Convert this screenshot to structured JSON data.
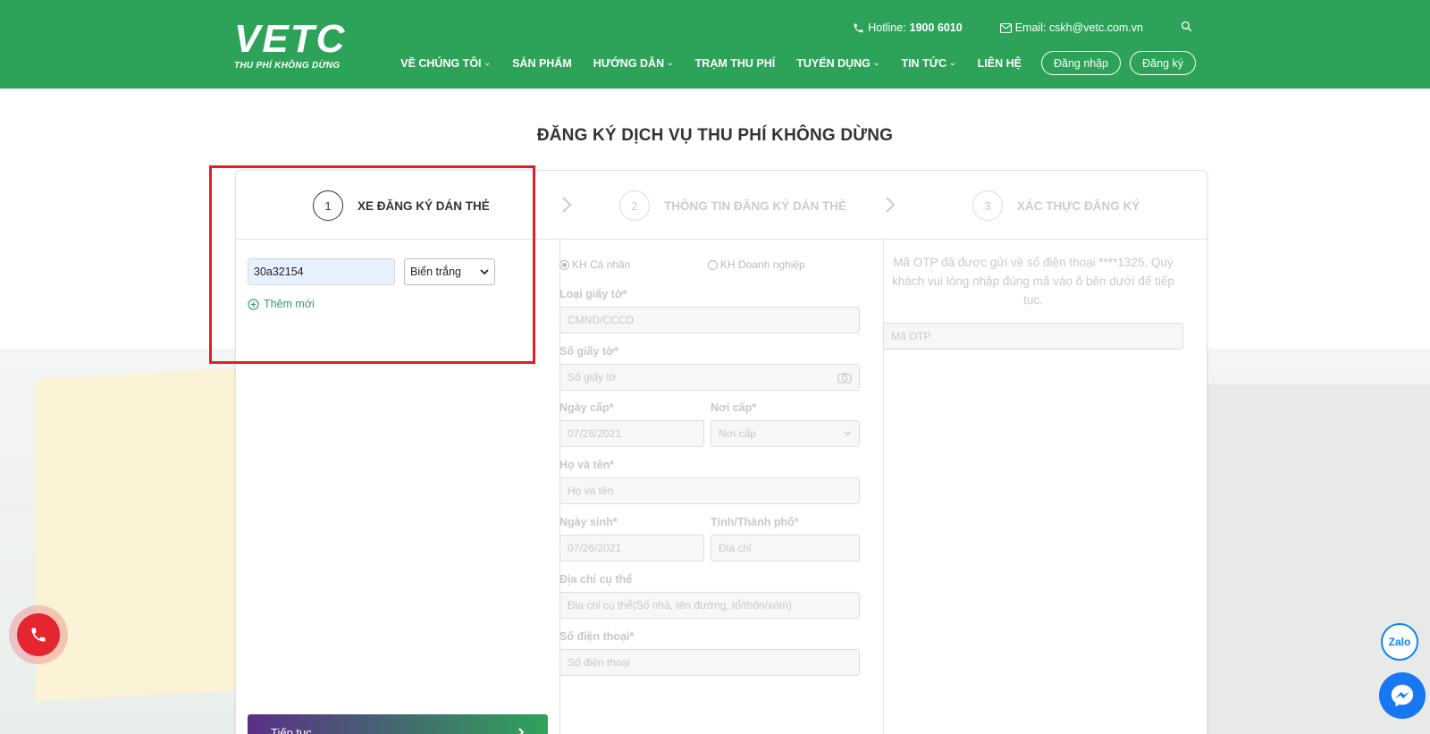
{
  "header": {
    "logo_text": "VETC",
    "logo_tagline": "THU PHÍ KHÔNG DỪNG",
    "hotline_label": "Hotline:",
    "hotline_number": "1900 6010",
    "email_text": "Email: cskh@vetc.com.vn",
    "nav": [
      {
        "label": "VỀ CHÚNG TÔI",
        "has_dropdown": true
      },
      {
        "label": "SẢN PHẨM",
        "has_dropdown": false
      },
      {
        "label": "HƯỚNG DẪN",
        "has_dropdown": true
      },
      {
        "label": "TRẠM THU PHÍ",
        "has_dropdown": false
      },
      {
        "label": "TUYỂN DỤNG",
        "has_dropdown": true
      },
      {
        "label": "TIN TỨC",
        "has_dropdown": true
      },
      {
        "label": "LIÊN HỆ",
        "has_dropdown": false
      }
    ],
    "login_label": "Đăng nhập",
    "register_label": "Đăng ký"
  },
  "page_title": "ĐĂNG KÝ DỊCH VỤ THU PHÍ KHÔNG DỪNG",
  "steps": [
    {
      "number": "1",
      "label": "XE ĐĂNG KÝ DÁN THẺ",
      "active": true
    },
    {
      "number": "2",
      "label": "THÔNG TIN ĐĂNG KÝ DÁN THẺ",
      "active": false
    },
    {
      "number": "3",
      "label": "XÁC THỰC ĐĂNG KÝ",
      "active": false
    }
  ],
  "vehicle": {
    "plate_value": "30a32154",
    "plate_type_selected": "Biển trắng",
    "add_new_label": "Thêm mới",
    "continue_label": "Tiếp tục"
  },
  "registration": {
    "customer_individual": "KH Cá nhân",
    "customer_business": "KH Doanh nghiệp",
    "doc_type_label": "Loại giấy tờ*",
    "doc_type_value": "CMND/CCCD",
    "doc_number_label": "Số giấy tờ*",
    "doc_number_placeholder": "Số giấy tờ",
    "issue_date_label": "Ngày cấp*",
    "issue_date_value": "07/26/2021",
    "issue_place_label": "Nơi cấp*",
    "issue_place_placeholder": "Nơi cấp",
    "full_name_label": "Họ và tên*",
    "full_name_placeholder": "Họ và tên",
    "dob_label": "Ngày sinh*",
    "dob_value": "07/26/2021",
    "province_label": "Tỉnh/Thành phố*",
    "province_placeholder": "Địa chỉ",
    "address_label": "Địa chỉ cụ thể",
    "address_placeholder": "Địa chỉ cụ thể(Số nhà, tên đường, tổ/thôn/xóm)",
    "phone_label": "Số điện thoại*",
    "phone_placeholder": "Số điện thoại"
  },
  "otp": {
    "message": "Mã OTP đã được gửi về số điện thoại ****1325, Quý khách vui lòng nhập đúng mã vào ô bên dưới để tiếp tục.",
    "placeholder": "Mã OTP"
  },
  "widgets": {
    "zalo_label": "Zalo"
  },
  "colors": {
    "brand_green": "#2da35a",
    "highlight_red": "#e01f26",
    "call_red": "#e52530",
    "messenger_blue": "#1877f2"
  }
}
